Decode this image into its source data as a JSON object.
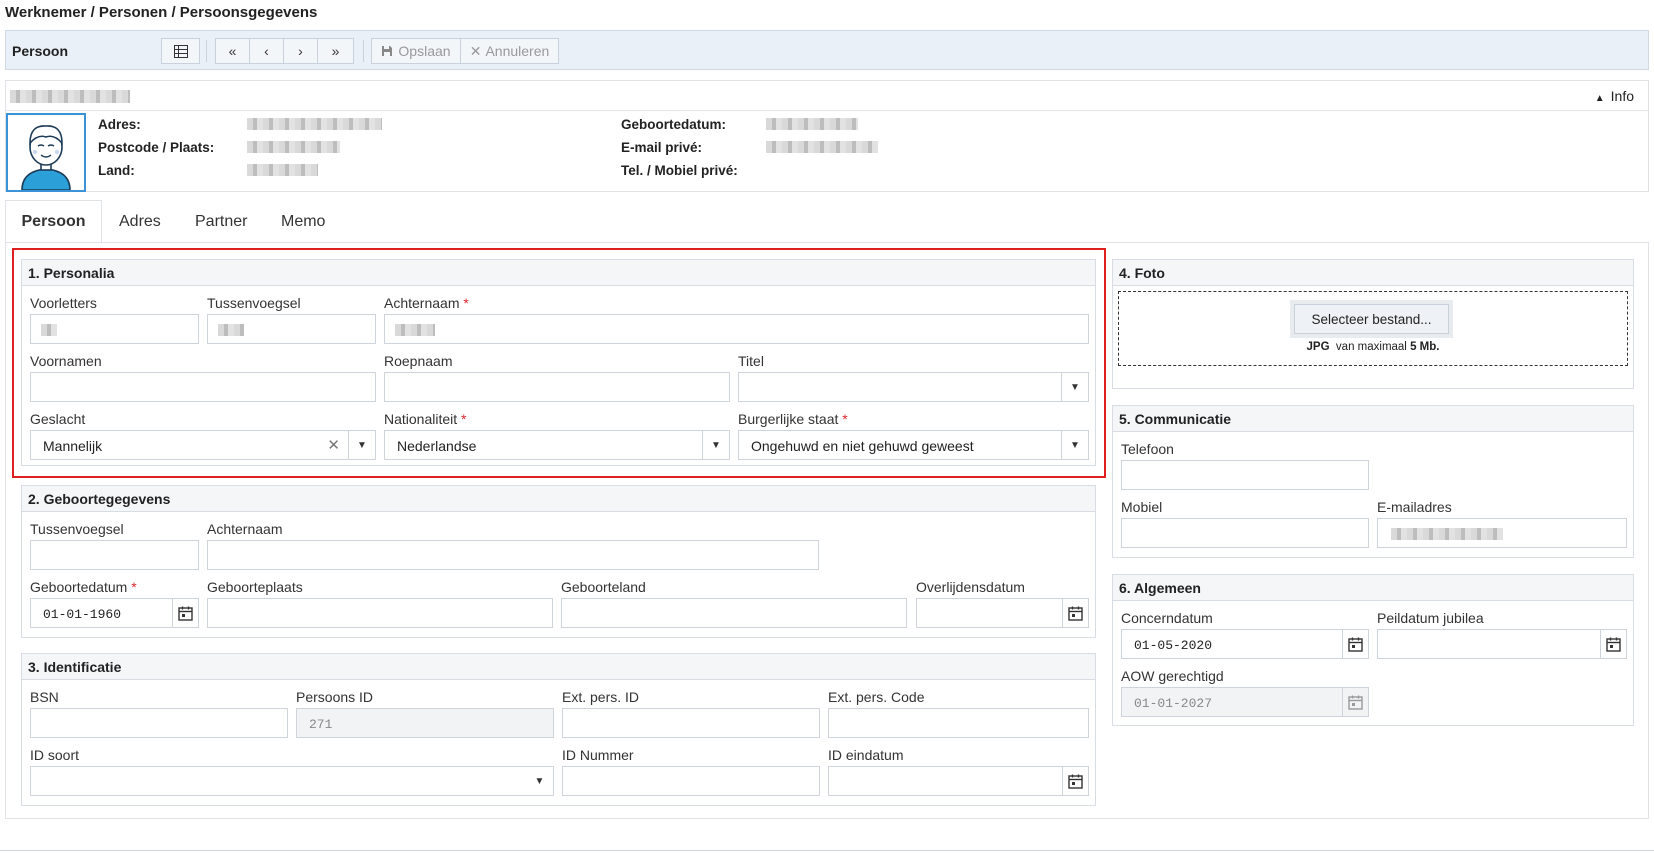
{
  "breadcrumb": "Werknemer / Personen / Persoonsgegevens",
  "toolbar": {
    "title": "Persoon",
    "save_label": "Opslaan",
    "cancel_label": "Annuleren",
    "icons": [
      "table-icon",
      "first-icon",
      "prev-icon",
      "next-icon",
      "last-icon",
      "save-icon",
      "close-icon"
    ]
  },
  "person_header": {
    "info_label": "Info",
    "labels": {
      "address": "Adres:",
      "postcode_city": "Postcode / Plaats:",
      "country": "Land:",
      "birthdate": "Geboortedatum:",
      "email_private": "E-mail privé:",
      "phone_private": "Tel. / Mobiel privé:"
    }
  },
  "tabs": [
    "Persoon",
    "Adres",
    "Partner",
    "Memo"
  ],
  "personalia": {
    "title": "1. Personalia",
    "voorletters_label": "Voorletters",
    "tussenvoegsel_label": "Tussenvoegsel",
    "achternaam_label": "Achternaam",
    "voornamen_label": "Voornamen",
    "roepnaam_label": "Roepnaam",
    "titel_label": "Titel",
    "geslacht_label": "Geslacht",
    "geslacht_value": "Mannelijk",
    "nationaliteit_label": "Nationaliteit",
    "nationaliteit_value": "Nederlandse",
    "burgerlijke_staat_label": "Burgerlijke staat",
    "burgerlijke_staat_value": "Ongehuwd en niet gehuwd geweest"
  },
  "geboorte": {
    "title": "2. Geboortegegevens",
    "tussenvoegsel_label": "Tussenvoegsel",
    "achternaam_label": "Achternaam",
    "geboortedatum_label": "Geboortedatum",
    "geboortedatum_value": "01-01-1960",
    "geboorteplaats_label": "Geboorteplaats",
    "geboorteland_label": "Geboorteland",
    "overlijdensdatum_label": "Overlijdensdatum"
  },
  "identificatie": {
    "title": "3. Identificatie",
    "bsn_label": "BSN",
    "persoons_id_label": "Persoons ID",
    "persoons_id_value": "271",
    "ext_pers_id_label": "Ext. pers. ID",
    "ext_pers_code_label": "Ext. pers. Code",
    "id_soort_label": "ID soort",
    "id_nummer_label": "ID Nummer",
    "id_eindatum_label": "ID eindatum"
  },
  "foto": {
    "title": "4. Foto",
    "button": "Selecteer bestand...",
    "hint_format": "JPG",
    "hint_mid": "van maximaal",
    "hint_size": "5 Mb."
  },
  "communicatie": {
    "title": "5. Communicatie",
    "telefoon_label": "Telefoon",
    "mobiel_label": "Mobiel",
    "email_label": "E-mailadres"
  },
  "algemeen": {
    "title": "6. Algemeen",
    "concerndatum_label": "Concerndatum",
    "concerndatum_value": "01-05-2020",
    "peildatum_label": "Peildatum jubilea",
    "aow_label": "AOW gerechtigd",
    "aow_value": "01-01-2027"
  },
  "colors": {
    "accent": "#3a93d6",
    "required": "#d9262e",
    "highlight_border": "#e02020",
    "toolbar_bg": "#e9f0f8"
  }
}
